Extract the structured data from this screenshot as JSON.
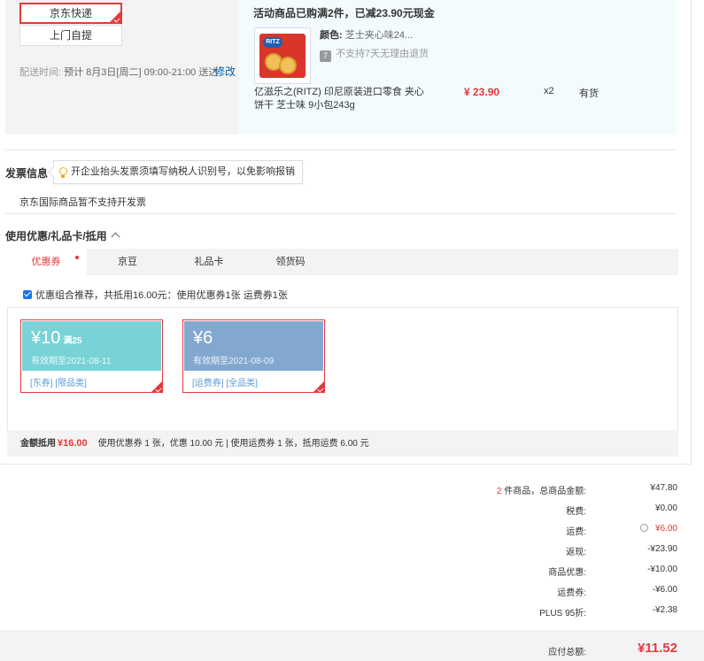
{
  "shipping": {
    "options": [
      {
        "label": "京东快递",
        "selected": true
      },
      {
        "label": "上门自提",
        "selected": false
      }
    ],
    "time_label": "配送时间:",
    "time_value": "预计 8月3日[周二] 09:00-21:00 送达",
    "edit_label": "修改"
  },
  "goods": {
    "promo": "活动商品已购满2件，已减23.90元现金",
    "attr_label": "颜色:",
    "attr_value": "芝士夹心味24...",
    "no_return_icon": "7",
    "no_return": "不支持7天无理由退货",
    "name": "亿滋乐之(RITZ) 印尼原装进口零食 夹心饼干 芝士味 9小包243g",
    "price": "¥ 23.90",
    "qty": "x2",
    "stock": "有货",
    "image_brand": "RITZ"
  },
  "invoice": {
    "title": "发票信息",
    "tip": "开企业抬头发票须填写纳税人识别号，以免影响报销",
    "note": "京东国际商品暂不支持开发票"
  },
  "coupons": {
    "title": "使用优惠/礼品卡/抵用",
    "tabs": [
      "优惠券",
      "京豆",
      "礼品卡",
      "领货码"
    ],
    "active_tab": "优惠券",
    "combo_text": "优惠组合推荐，共抵用16.00元：使用优惠券1张 运费券1张",
    "items": [
      {
        "amount": "¥10",
        "condition": "满25",
        "expiry": "有效期至2021-08-11",
        "tags": "[东券]  [限品类]",
        "color": "#79d3d6"
      },
      {
        "amount": "¥6",
        "condition": "",
        "expiry": "有效期至2021-08-09",
        "tags": "[运费券]  [全品类]",
        "color": "#83a8cf"
      }
    ],
    "summary_label": "金额抵用",
    "summary_amount": "¥16.00",
    "summary_detail": "使用优惠券 1 张，优惠 10.00 元 | 使用运费券 1 张，抵用运费 6.00 元"
  },
  "totals": {
    "count": "2",
    "rows": [
      {
        "label": "件商品，总商品金额:",
        "value": "¥47.80"
      },
      {
        "label": "税费:",
        "value": "¥0.00"
      },
      {
        "label": "运费:",
        "value": "¥6.00"
      },
      {
        "label": "返现:",
        "value": "-¥23.90"
      },
      {
        "label": "商品优惠:",
        "value": "-¥10.00"
      },
      {
        "label": "运费券:",
        "value": "-¥6.00"
      },
      {
        "label": "PLUS 95折:",
        "value": "-¥2.38"
      }
    ],
    "payable_label": "应付总额:",
    "payable_value": "¥11.52"
  },
  "colors": {
    "accent": "#e4393c",
    "link": "#005ea7",
    "panel_gray": "#f3f3f3",
    "panel_blue": "#f3fbfe"
  }
}
